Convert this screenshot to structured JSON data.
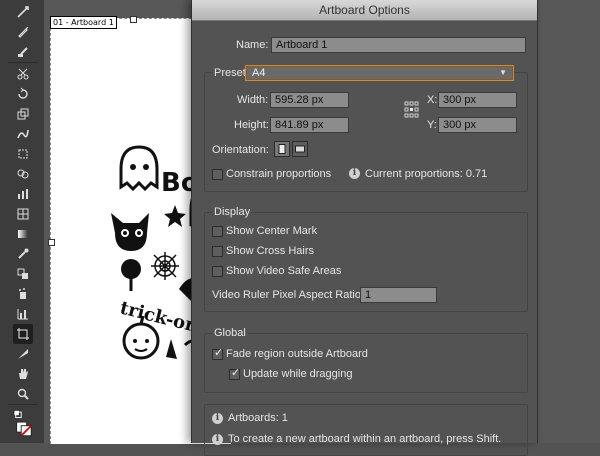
{
  "artboard": {
    "label": "01 - Artboard 1"
  },
  "dialog": {
    "title": "Artboard Options",
    "name_label": "Name:",
    "name_value": "Artboard 1",
    "preset_label": "Preset:",
    "preset_value": "A4",
    "width_label": "Width:",
    "width_value": "595.28 px",
    "height_label": "Height:",
    "height_value": "841.89 px",
    "x_label": "X:",
    "x_value": "300 px",
    "y_label": "Y:",
    "y_value": "300 px",
    "orientation_label": "Orientation:",
    "constrain_label": "Constrain proportions",
    "current_proportions": "Current proportions: 0.71",
    "display": {
      "title": "Display",
      "center_mark": "Show Center Mark",
      "cross_hairs": "Show Cross Hairs",
      "video_safe": "Show Video Safe Areas",
      "par_label": "Video Ruler Pixel Aspect Ratio:",
      "par_value": "1"
    },
    "global": {
      "title": "Global",
      "fade_region": "Fade region outside Artboard",
      "update_dragging": "Update while dragging"
    },
    "info": {
      "artboards": "Artboards: 1",
      "tip": "To create a new artboard within an artboard, press Shift."
    }
  },
  "icons": [
    "selection-icon",
    "pen-icon",
    "pencil-icon",
    "brush-icon",
    "scissors-icon",
    "rotate-icon",
    "scale-icon",
    "warp-icon",
    "free-transform-icon",
    "shape-builder-icon",
    "graph-icon",
    "mesh-icon",
    "gradient-icon",
    "eyedropper-icon",
    "blend-icon",
    "symbol-sprayer-icon",
    "column-graph-icon",
    "artboard-tool-icon",
    "slice-icon",
    "hand-icon",
    "zoom-icon",
    "fill-stroke-icon"
  ],
  "colors": {
    "dialog_bg": "#535353",
    "field_bg": "#8c8c8c",
    "preset_border": "#c98a3a"
  }
}
